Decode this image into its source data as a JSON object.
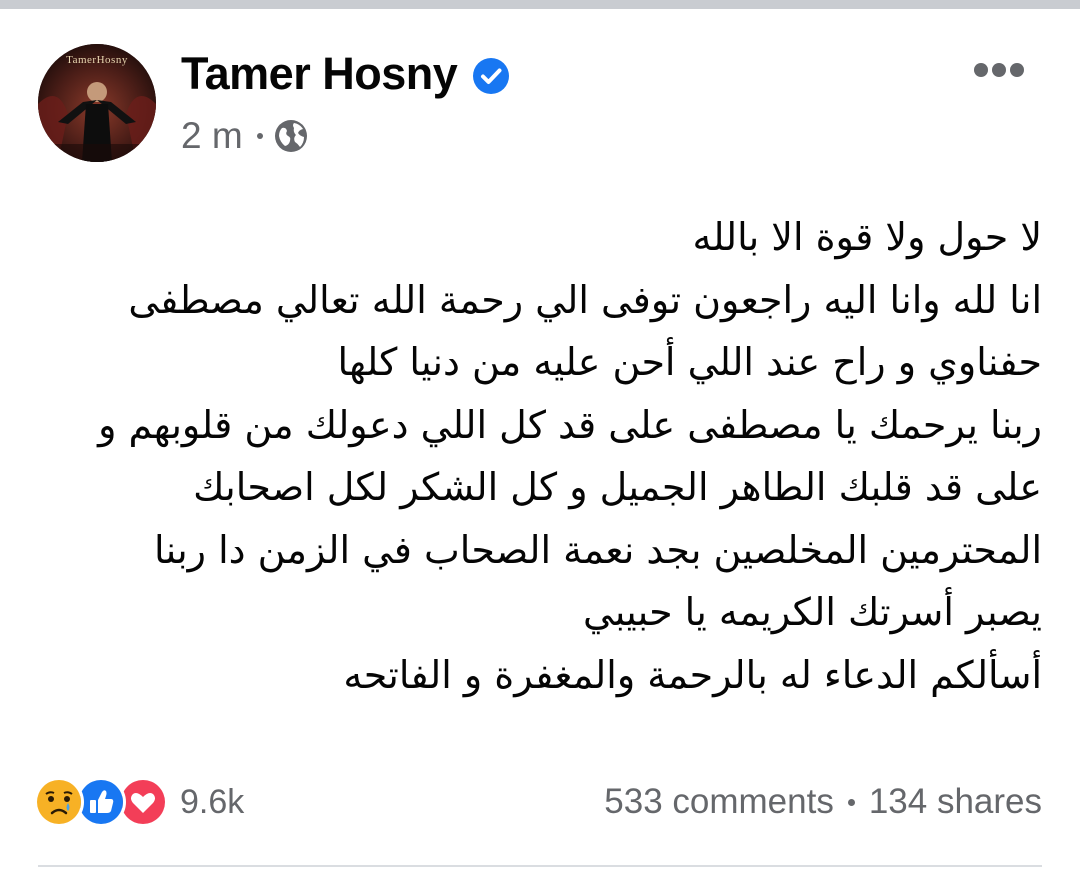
{
  "post": {
    "author": "Tamer Hosny",
    "avatar_caption": "TamerHosny",
    "timestamp": "2 m",
    "audience_icon": "globe-icon",
    "more_icon": "more-horizontal-icon",
    "verified_icon": "verified-badge-icon",
    "text_lines": [
      "لا حول ولا قوة الا بالله",
      "انا لله وانا اليه راجعون توفى الي رحمة الله تعالي  مصطفى",
      "حفناوي  و راح عند اللي أحن عليه من دنيا كلها",
      "ربنا يرحمك يا مصطفى على قد كل اللي دعولك من قلوبهم و",
      "على قد قلبك الطاهر الجميل و كل الشكر لكل اصحابك",
      "المحترمين المخلصين بجد نعمة الصحاب في الزمن دا  ربنا",
      "يصبر  أسرتك الكريمه يا حبيبي",
      "أسألكم الدعاء له بالرحمة والمغفرة و الفاتحه"
    ]
  },
  "reactions": {
    "icons": [
      "sad-reaction-icon",
      "like-reaction-icon",
      "love-reaction-icon"
    ],
    "count": "9.6k"
  },
  "stats": {
    "comments": "533 comments",
    "shares": "134 shares"
  },
  "colors": {
    "text_primary": "#050505",
    "text_secondary": "#65676b",
    "facebook_blue": "#1877f2",
    "love_red": "#f33e58",
    "sad_yellow": "#f7b125"
  }
}
